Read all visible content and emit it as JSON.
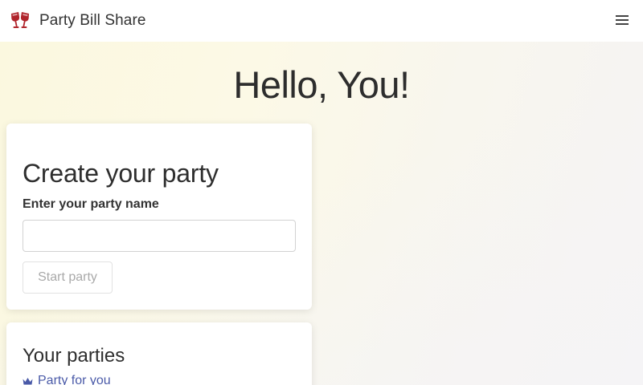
{
  "app": {
    "title": "Party Bill Share",
    "logo_icon": "wine-glasses-icon",
    "menu_icon": "hamburger-menu-icon"
  },
  "hero": {
    "greeting": "Hello, You!"
  },
  "create_party": {
    "title": "Create your party",
    "name_label": "Enter your party name",
    "name_value": "",
    "name_placeholder": "",
    "start_button": "Start party"
  },
  "parties": {
    "title": "Your parties",
    "items": [
      {
        "name": "Party for you",
        "icon": "crown-icon"
      }
    ]
  },
  "colors": {
    "logo": "#b0242b",
    "link": "#4a5aa8",
    "hero_bg": "#fbf8df"
  }
}
